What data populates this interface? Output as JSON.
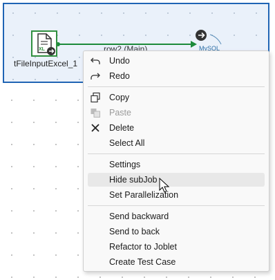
{
  "canvas": {
    "source_component": {
      "label": "tFileInputExcel_1",
      "icon": "excel-file-icon"
    },
    "target_component": {
      "icon": "mysql-database-icon",
      "logo_text": "MySQL"
    },
    "connection": {
      "label": "row2 (Main)"
    }
  },
  "context_menu": {
    "undo": "Undo",
    "redo": "Redo",
    "copy": "Copy",
    "paste": "Paste",
    "delete": "Delete",
    "select_all": "Select All",
    "settings": "Settings",
    "hide_subjob": "Hide subJob",
    "set_parallelization": "Set Parallelization",
    "send_backward": "Send backward",
    "send_to_back": "Send to back",
    "refactor_to_joblet": "Refactor to Joblet",
    "create_test_case": "Create Test Case"
  },
  "colors": {
    "subjob_border": "#1f64b4",
    "subjob_fill": "#eaf1fa",
    "connection_line": "#1b8a3a",
    "menu_background": "#f9f9f9",
    "menu_hover": "#e8e8e8"
  }
}
